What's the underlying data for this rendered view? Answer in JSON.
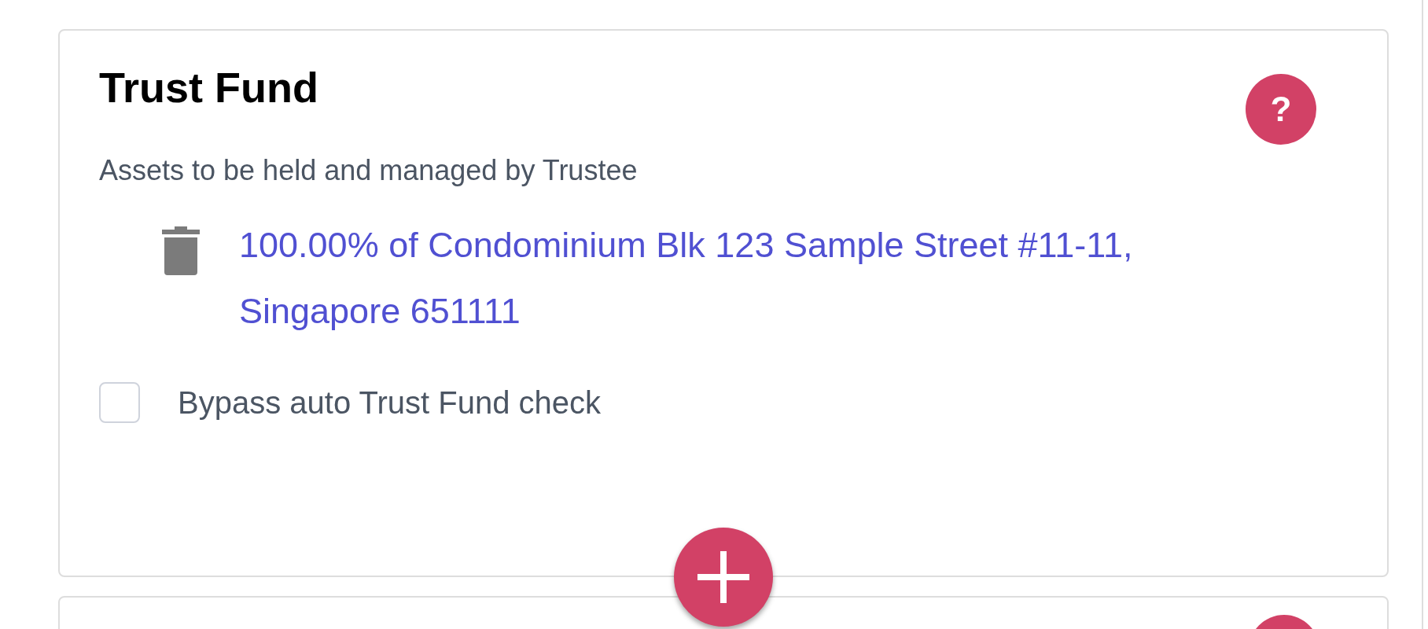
{
  "card": {
    "title": "Trust Fund",
    "subtitle": "Assets to be held and managed by Trustee",
    "help": "?",
    "assets": [
      {
        "text": "100.00% of Condominium Blk 123 Sample Street #11-11, Singapore 651111"
      }
    ],
    "bypass": {
      "label": "Bypass auto Trust Fund check",
      "checked": false
    }
  }
}
